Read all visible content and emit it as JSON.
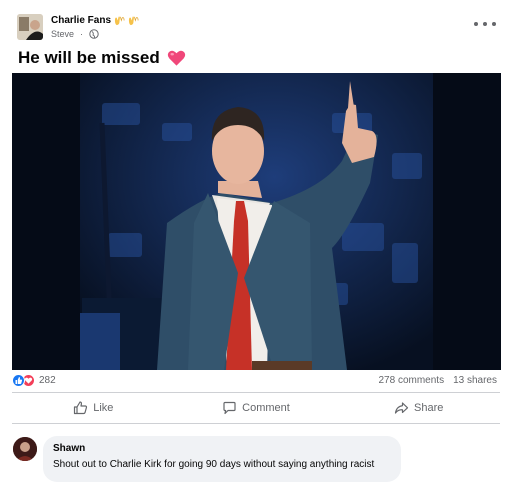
{
  "post": {
    "group_name": "Charlie Fans",
    "group_emoji": "raising-hands-emoji",
    "author": "Steve",
    "privacy_icon": "globe-icon",
    "text": "He will be missed",
    "text_emoji": "pink-heart-emoji"
  },
  "stats": {
    "reaction_icons": [
      "like-icon",
      "love-icon"
    ],
    "reaction_count": "282",
    "comments": "278 comments",
    "shares": "13 shares"
  },
  "actions": {
    "like": "Like",
    "comment": "Comment",
    "share": "Share"
  },
  "comment": {
    "author": "Shawn",
    "text": "Shout out to Charlie Kirk for going 90 days without saying anything racist"
  },
  "colors": {
    "brand_blue": "#1877f2",
    "love_red": "#f33e58",
    "secondary_text": "#65676b",
    "bubble_bg": "#f0f2f5"
  }
}
